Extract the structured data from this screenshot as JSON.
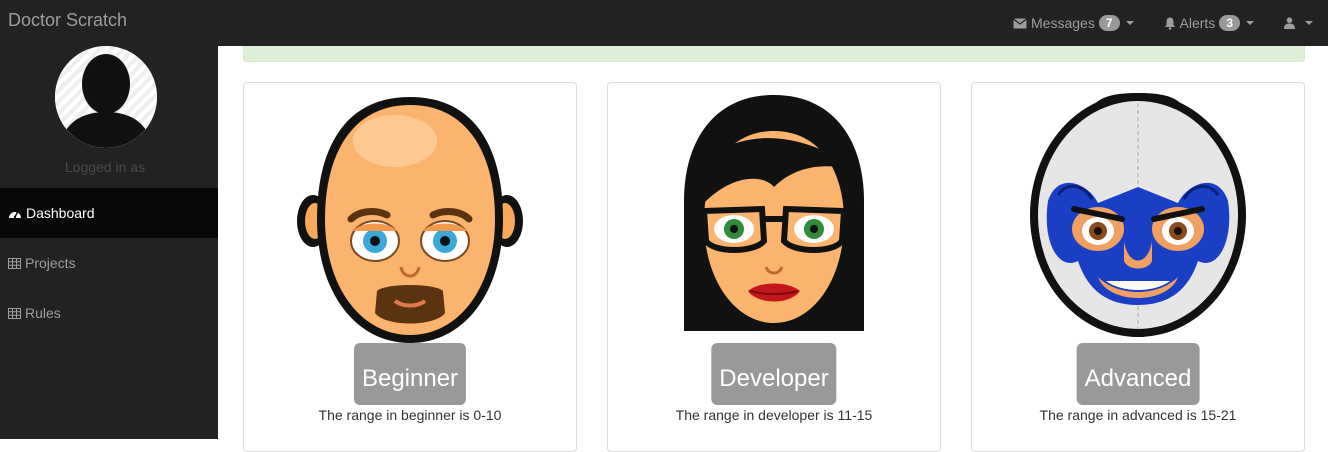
{
  "brand": "Doctor Scratch",
  "nav": {
    "messages": {
      "label": "Messages",
      "count": "7"
    },
    "alerts": {
      "label": "Alerts",
      "count": "3"
    }
  },
  "sidebar": {
    "logged_in": "Logged in as",
    "items": [
      {
        "label": "Dashboard",
        "icon": "dashboard-icon"
      },
      {
        "label": "Projects",
        "icon": "table-icon"
      },
      {
        "label": "Rules",
        "icon": "table-icon"
      }
    ]
  },
  "levels": [
    {
      "label": "Beginner",
      "range": "The range in beginner is 0-10"
    },
    {
      "label": "Developer",
      "range": "The range in developer is 11-15"
    },
    {
      "label": "Advanced",
      "range": "The range in advanced is 15-21"
    }
  ],
  "colors": {
    "navbar": "#222222",
    "sidebar_active": "#080808",
    "badge": "#999999",
    "alert_success": "#dff0d8",
    "mask_blue": "#1a3fc4"
  }
}
